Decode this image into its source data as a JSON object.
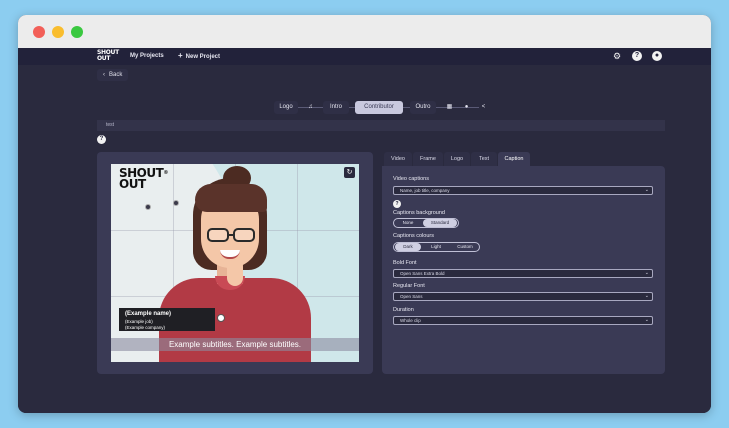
{
  "nav": {
    "logo_line1": "SHOUT",
    "logo_line2": "OUT",
    "my_projects": "My Projects",
    "new_project": "New Project",
    "new_project_icon": "plus-icon",
    "settings_icon": "gear-icon",
    "help_icon": "question-icon",
    "account_icon": "user-icon"
  },
  "back": {
    "label": "Back",
    "icon": "chevron-left-icon"
  },
  "timeline": {
    "items": [
      "Logo",
      "Intro",
      "Contributor",
      "Outro"
    ],
    "active": "Contributor",
    "icons": [
      "music-icon",
      "grid-icon",
      "chat-icon",
      "share-icon"
    ]
  },
  "project_title": "test",
  "help_label": "?",
  "preview": {
    "logo_line1": "SHOUT",
    "logo_line2": "OUT",
    "logo_mark": "®",
    "refresh_icon": "refresh-icon",
    "name": "(Example name)",
    "job": "(Example job)",
    "company": "(Example company)",
    "subtitles": "Example subtitles. Example subtitles."
  },
  "settings": {
    "tabs": [
      "Video",
      "Frame",
      "Logo",
      "Text",
      "Caption"
    ],
    "active_tab": "Caption",
    "video_captions_label": "Video captions",
    "video_captions_value": "Name, job title, company",
    "captions_background_label": "Captions background",
    "captions_background_options": [
      "None",
      "Standard"
    ],
    "captions_background_selected": "Standard",
    "captions_colours_label": "Captions colours",
    "captions_colours_options": [
      "Dark",
      "Light",
      "Custom"
    ],
    "captions_colours_selected": "Dark",
    "bold_font_label": "Bold Font",
    "bold_font_value": "Open Sans Extra Bold",
    "regular_font_label": "Regular Font",
    "regular_font_value": "Open Sans",
    "duration_label": "Duration",
    "duration_value": "Whole clip"
  },
  "colors": {
    "background": "#8ccdf0",
    "app_bg": "#2a2a3e",
    "panel": "#3a3a55",
    "active_pill": "#c9c9de"
  }
}
